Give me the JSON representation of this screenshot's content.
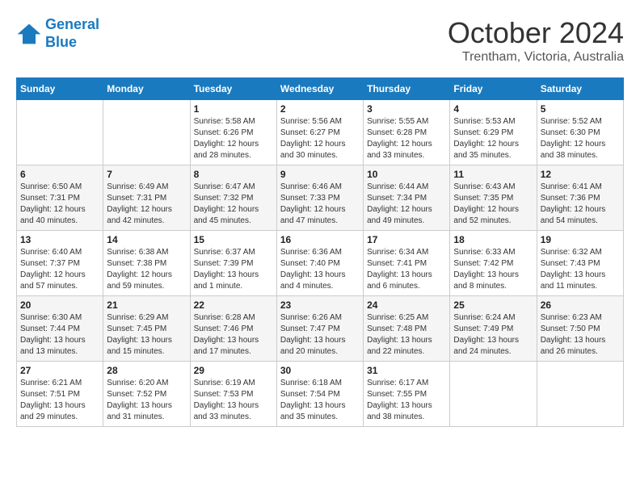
{
  "logo": {
    "line1": "General",
    "line2": "Blue"
  },
  "title": "October 2024",
  "location": "Trentham, Victoria, Australia",
  "days_of_week": [
    "Sunday",
    "Monday",
    "Tuesday",
    "Wednesday",
    "Thursday",
    "Friday",
    "Saturday"
  ],
  "weeks": [
    [
      {
        "day": "",
        "sunrise": "",
        "sunset": "",
        "daylight": ""
      },
      {
        "day": "",
        "sunrise": "",
        "sunset": "",
        "daylight": ""
      },
      {
        "day": "1",
        "sunrise": "Sunrise: 5:58 AM",
        "sunset": "Sunset: 6:26 PM",
        "daylight": "Daylight: 12 hours and 28 minutes."
      },
      {
        "day": "2",
        "sunrise": "Sunrise: 5:56 AM",
        "sunset": "Sunset: 6:27 PM",
        "daylight": "Daylight: 12 hours and 30 minutes."
      },
      {
        "day": "3",
        "sunrise": "Sunrise: 5:55 AM",
        "sunset": "Sunset: 6:28 PM",
        "daylight": "Daylight: 12 hours and 33 minutes."
      },
      {
        "day": "4",
        "sunrise": "Sunrise: 5:53 AM",
        "sunset": "Sunset: 6:29 PM",
        "daylight": "Daylight: 12 hours and 35 minutes."
      },
      {
        "day": "5",
        "sunrise": "Sunrise: 5:52 AM",
        "sunset": "Sunset: 6:30 PM",
        "daylight": "Daylight: 12 hours and 38 minutes."
      }
    ],
    [
      {
        "day": "6",
        "sunrise": "Sunrise: 6:50 AM",
        "sunset": "Sunset: 7:31 PM",
        "daylight": "Daylight: 12 hours and 40 minutes."
      },
      {
        "day": "7",
        "sunrise": "Sunrise: 6:49 AM",
        "sunset": "Sunset: 7:31 PM",
        "daylight": "Daylight: 12 hours and 42 minutes."
      },
      {
        "day": "8",
        "sunrise": "Sunrise: 6:47 AM",
        "sunset": "Sunset: 7:32 PM",
        "daylight": "Daylight: 12 hours and 45 minutes."
      },
      {
        "day": "9",
        "sunrise": "Sunrise: 6:46 AM",
        "sunset": "Sunset: 7:33 PM",
        "daylight": "Daylight: 12 hours and 47 minutes."
      },
      {
        "day": "10",
        "sunrise": "Sunrise: 6:44 AM",
        "sunset": "Sunset: 7:34 PM",
        "daylight": "Daylight: 12 hours and 49 minutes."
      },
      {
        "day": "11",
        "sunrise": "Sunrise: 6:43 AM",
        "sunset": "Sunset: 7:35 PM",
        "daylight": "Daylight: 12 hours and 52 minutes."
      },
      {
        "day": "12",
        "sunrise": "Sunrise: 6:41 AM",
        "sunset": "Sunset: 7:36 PM",
        "daylight": "Daylight: 12 hours and 54 minutes."
      }
    ],
    [
      {
        "day": "13",
        "sunrise": "Sunrise: 6:40 AM",
        "sunset": "Sunset: 7:37 PM",
        "daylight": "Daylight: 12 hours and 57 minutes."
      },
      {
        "day": "14",
        "sunrise": "Sunrise: 6:38 AM",
        "sunset": "Sunset: 7:38 PM",
        "daylight": "Daylight: 12 hours and 59 minutes."
      },
      {
        "day": "15",
        "sunrise": "Sunrise: 6:37 AM",
        "sunset": "Sunset: 7:39 PM",
        "daylight": "Daylight: 13 hours and 1 minute."
      },
      {
        "day": "16",
        "sunrise": "Sunrise: 6:36 AM",
        "sunset": "Sunset: 7:40 PM",
        "daylight": "Daylight: 13 hours and 4 minutes."
      },
      {
        "day": "17",
        "sunrise": "Sunrise: 6:34 AM",
        "sunset": "Sunset: 7:41 PM",
        "daylight": "Daylight: 13 hours and 6 minutes."
      },
      {
        "day": "18",
        "sunrise": "Sunrise: 6:33 AM",
        "sunset": "Sunset: 7:42 PM",
        "daylight": "Daylight: 13 hours and 8 minutes."
      },
      {
        "day": "19",
        "sunrise": "Sunrise: 6:32 AM",
        "sunset": "Sunset: 7:43 PM",
        "daylight": "Daylight: 13 hours and 11 minutes."
      }
    ],
    [
      {
        "day": "20",
        "sunrise": "Sunrise: 6:30 AM",
        "sunset": "Sunset: 7:44 PM",
        "daylight": "Daylight: 13 hours and 13 minutes."
      },
      {
        "day": "21",
        "sunrise": "Sunrise: 6:29 AM",
        "sunset": "Sunset: 7:45 PM",
        "daylight": "Daylight: 13 hours and 15 minutes."
      },
      {
        "day": "22",
        "sunrise": "Sunrise: 6:28 AM",
        "sunset": "Sunset: 7:46 PM",
        "daylight": "Daylight: 13 hours and 17 minutes."
      },
      {
        "day": "23",
        "sunrise": "Sunrise: 6:26 AM",
        "sunset": "Sunset: 7:47 PM",
        "daylight": "Daylight: 13 hours and 20 minutes."
      },
      {
        "day": "24",
        "sunrise": "Sunrise: 6:25 AM",
        "sunset": "Sunset: 7:48 PM",
        "daylight": "Daylight: 13 hours and 22 minutes."
      },
      {
        "day": "25",
        "sunrise": "Sunrise: 6:24 AM",
        "sunset": "Sunset: 7:49 PM",
        "daylight": "Daylight: 13 hours and 24 minutes."
      },
      {
        "day": "26",
        "sunrise": "Sunrise: 6:23 AM",
        "sunset": "Sunset: 7:50 PM",
        "daylight": "Daylight: 13 hours and 26 minutes."
      }
    ],
    [
      {
        "day": "27",
        "sunrise": "Sunrise: 6:21 AM",
        "sunset": "Sunset: 7:51 PM",
        "daylight": "Daylight: 13 hours and 29 minutes."
      },
      {
        "day": "28",
        "sunrise": "Sunrise: 6:20 AM",
        "sunset": "Sunset: 7:52 PM",
        "daylight": "Daylight: 13 hours and 31 minutes."
      },
      {
        "day": "29",
        "sunrise": "Sunrise: 6:19 AM",
        "sunset": "Sunset: 7:53 PM",
        "daylight": "Daylight: 13 hours and 33 minutes."
      },
      {
        "day": "30",
        "sunrise": "Sunrise: 6:18 AM",
        "sunset": "Sunset: 7:54 PM",
        "daylight": "Daylight: 13 hours and 35 minutes."
      },
      {
        "day": "31",
        "sunrise": "Sunrise: 6:17 AM",
        "sunset": "Sunset: 7:55 PM",
        "daylight": "Daylight: 13 hours and 38 minutes."
      },
      {
        "day": "",
        "sunrise": "",
        "sunset": "",
        "daylight": ""
      },
      {
        "day": "",
        "sunrise": "",
        "sunset": "",
        "daylight": ""
      }
    ]
  ]
}
